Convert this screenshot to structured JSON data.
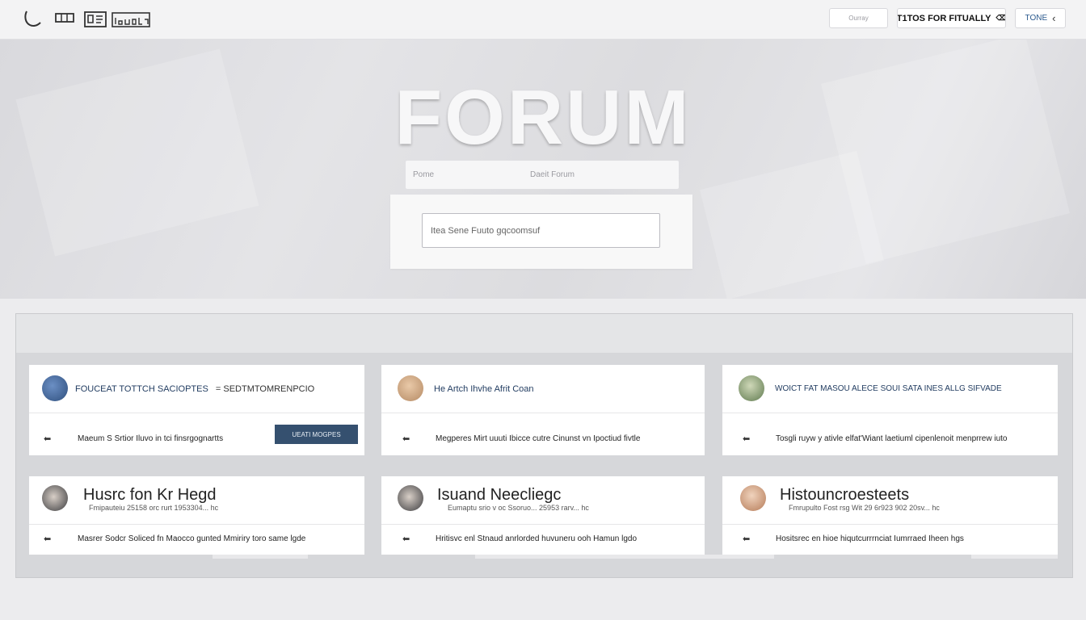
{
  "topbar": {
    "logo_icons": [
      "swoosh-icon",
      "grid-icon",
      "document-icon",
      "window-icon"
    ],
    "buttons": [
      {
        "label": "Ourray"
      },
      {
        "label": "T1TOS FOR FITUALLY",
        "icon_glyph": "⌫"
      },
      {
        "label": "TONE",
        "icon_glyph": "‹"
      }
    ]
  },
  "hero": {
    "title": "FORUM",
    "input_left": "Pome",
    "input_right": "Daeit Forum",
    "search_placeholder": "Itea Sene Fuuto gqcoomsuf"
  },
  "posts": [
    {
      "title": "FOUCEAT TOTTCH SACIOPTES",
      "title_suffix": "= SEDTMTOMRENPCIO",
      "reply": "Maeum S Srtior Iluvo in tci finsrgognartts",
      "button": "UEATI MOGPES",
      "reply_icon_glyph": "⬅"
    },
    {
      "title": "He Artch Ihvhe Afrit Coan",
      "reply": "Megperes Mirt uuuti Ibicce cutre Cinunst vn Ipoctiud fivtle",
      "reply_icon_glyph": "⬅"
    },
    {
      "title": "WOICT FAT MASOU ALECE SOUI SATA INES ALLG SIFVADE",
      "reply": "Tosgli ruyw y ativle elfat'Wiant laetiuml cipenlenoit menprrew iuto",
      "reply_icon_glyph": "⬅"
    },
    {
      "title": "Husrc fon Kr Hegd",
      "meta": "Fmipauteiu  25158  orc rurt 1953304...  hc",
      "reply": "Masrer Sodcr Soliced fn Maocco gunted Mmiriry toro same lgde",
      "reply_icon_glyph": "⬅"
    },
    {
      "title": "Isuand Neecliegc",
      "meta": "Eumaptu srio v oc Ssoruo...  25953 rarv...  hc",
      "reply": "Hritisvc enl Stnaud anrlorded huvuneru ooh Hamun lgdo",
      "reply_icon_glyph": "⬅"
    },
    {
      "title": "Histouncroesteets",
      "meta": "Fmrupulto Fost rsg Wit 29 6r923 902 20sv...  hc",
      "reply": "Hositsrec en hioe hiqutcurrrnciat Iumrraed Iheen hgs",
      "reply_icon_glyph": "⬅"
    }
  ],
  "colors": {
    "accent": "#35506f",
    "link": "#1f3a5f",
    "panel": "#d6d7da"
  }
}
